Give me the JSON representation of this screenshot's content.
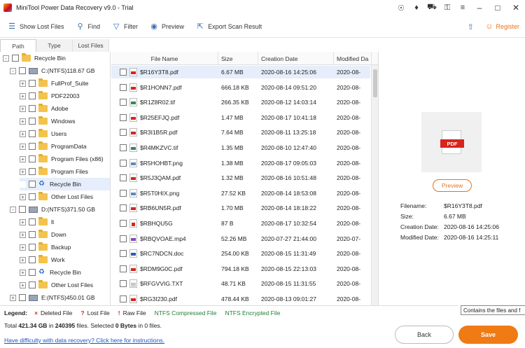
{
  "window": {
    "title": "MiniTool Power Data Recovery v9.0 - Trial",
    "title_icons": [
      "support-icon",
      "tag-icon",
      "cart-icon",
      "key-icon",
      "menu-icon"
    ],
    "controls": [
      "minimize",
      "maximize",
      "close"
    ]
  },
  "toolbar": {
    "show_lost_files": "Show Lost Files",
    "find": "Find",
    "filter": "Filter",
    "preview": "Preview",
    "export_scan_result": "Export Scan Result",
    "register": "Register"
  },
  "tabs": [
    "Path",
    "Type",
    "Lost Files"
  ],
  "tree": [
    {
      "label": "Recycle Bin",
      "icon": "folder",
      "level": 0,
      "expander": "-"
    },
    {
      "label": "C:(NTFS)118.67 GB",
      "icon": "drive",
      "level": 1,
      "expander": "-"
    },
    {
      "label": "FullProf_Suite",
      "icon": "folder",
      "level": 2,
      "expander": "+"
    },
    {
      "label": "PDF22003",
      "icon": "folder",
      "level": 2,
      "expander": "+"
    },
    {
      "label": "Adobe",
      "icon": "folder",
      "level": 2,
      "expander": "+"
    },
    {
      "label": "Windows",
      "icon": "folder",
      "level": 2,
      "expander": "+"
    },
    {
      "label": "Users",
      "icon": "folder",
      "level": 2,
      "expander": "+"
    },
    {
      "label": "ProgramData",
      "icon": "folder",
      "level": 2,
      "expander": "+"
    },
    {
      "label": "Program Files (x86)",
      "icon": "folder",
      "level": 2,
      "expander": "+"
    },
    {
      "label": "Program Files",
      "icon": "folder",
      "level": 2,
      "expander": "+"
    },
    {
      "label": "Recycle Bin",
      "icon": "recycle",
      "level": 2,
      "expander": "",
      "selected": true
    },
    {
      "label": "Other Lost Files",
      "icon": "folder",
      "level": 2,
      "expander": "+"
    },
    {
      "label": "D:(NTFS)371.50 GB",
      "icon": "drive",
      "level": 1,
      "expander": "-"
    },
    {
      "label": "lt",
      "icon": "folder",
      "level": 2,
      "expander": "+"
    },
    {
      "label": "Down",
      "icon": "folder",
      "level": 2,
      "expander": "+"
    },
    {
      "label": "Backup",
      "icon": "folder",
      "level": 2,
      "expander": "+"
    },
    {
      "label": "Work",
      "icon": "folder",
      "level": 2,
      "expander": "+"
    },
    {
      "label": "Recycle Bin",
      "icon": "recycle",
      "level": 2,
      "expander": "+"
    },
    {
      "label": "Other Lost Files",
      "icon": "folder",
      "level": 2,
      "expander": "+"
    },
    {
      "label": "E:(NTFS)450.01 GB",
      "icon": "drive",
      "level": 1,
      "expander": "+"
    }
  ],
  "filelist": {
    "columns": [
      "File Name",
      "Size",
      "Creation Date",
      "Modified Da"
    ],
    "rows": [
      {
        "name": "$R16Y3T8.pdf",
        "size": "6.67 MB",
        "created": "2020-08-16 14:25:06",
        "modified": "2020-08-",
        "type": "pdf",
        "selected": true
      },
      {
        "name": "$R1HONN7.pdf",
        "size": "666.18 KB",
        "created": "2020-08-14 09:51:20",
        "modified": "2020-08-",
        "type": "pdf"
      },
      {
        "name": "$R1Z8R02.tif",
        "size": "266.35 KB",
        "created": "2020-08-12 14:03:14",
        "modified": "2020-08-",
        "type": "tif"
      },
      {
        "name": "$R25EFJQ.pdf",
        "size": "1.47 MB",
        "created": "2020-08-17 10:41:18",
        "modified": "2020-08-",
        "type": "pdf"
      },
      {
        "name": "$R3I1B5R.pdf",
        "size": "7.64 MB",
        "created": "2020-08-11 13:25:18",
        "modified": "2020-08-",
        "type": "pdf"
      },
      {
        "name": "$R4MKZVC.tif",
        "size": "1.35 MB",
        "created": "2020-08-10 12:47:40",
        "modified": "2020-08-",
        "type": "tif"
      },
      {
        "name": "$R5HOHBT.png",
        "size": "1.38 MB",
        "created": "2020-08-17 09:05:03",
        "modified": "2020-08-",
        "type": "png"
      },
      {
        "name": "$R5J3QAM.pdf",
        "size": "1.32 MB",
        "created": "2020-08-16 10:51:48",
        "modified": "2020-08-",
        "type": "pdf"
      },
      {
        "name": "$R5T0HIX.png",
        "size": "27.52 KB",
        "created": "2020-08-14 18:53:08",
        "modified": "2020-08-",
        "type": "png"
      },
      {
        "name": "$RB6UN5R.pdf",
        "size": "1.70 MB",
        "created": "2020-08-14 18:18:22",
        "modified": "2020-08-",
        "type": "pdf"
      },
      {
        "name": "$RBHQU5G",
        "size": "87 B",
        "created": "2020-08-17 10:32:54",
        "modified": "2020-08-",
        "type": "gen"
      },
      {
        "name": "$RBQVOAE.mp4",
        "size": "52.26 MB",
        "created": "2020-07-27 21:44:00",
        "modified": "2020-07-",
        "type": "mp4"
      },
      {
        "name": "$RC7NDCN.doc",
        "size": "254.00 KB",
        "created": "2020-08-15 11:31:49",
        "modified": "2020-08-",
        "type": "doc"
      },
      {
        "name": "$RDM9G0C.pdf",
        "size": "794.18 KB",
        "created": "2020-08-15 22:13:03",
        "modified": "2020-08-",
        "type": "pdf"
      },
      {
        "name": "$RFGVVIG.TXT",
        "size": "48.71 KB",
        "created": "2020-08-15 11:31:55",
        "modified": "2020-08-",
        "type": "txt"
      },
      {
        "name": "$RG3I230.pdf",
        "size": "478.44 KB",
        "created": "2020-08-13 09:01:27",
        "modified": "2020-08-",
        "type": "pdf"
      }
    ]
  },
  "preview_panel": {
    "thumb_label": "PDF",
    "button": "Preview",
    "fields": [
      {
        "key": "Filename:",
        "value": "$R16Y3T8.pdf"
      },
      {
        "key": "Size:",
        "value": "6.67 MB"
      },
      {
        "key": "Creation Date:",
        "value": "2020-08-16 14:25:06"
      },
      {
        "key": "Modified Date:",
        "value": "2020-08-16 14:25:11"
      }
    ]
  },
  "tooltip": "Contains the files and f",
  "legend": {
    "title": "Legend:",
    "items": [
      {
        "mark": "×",
        "label": "Deleted File"
      },
      {
        "mark": "?",
        "label": "Lost File"
      },
      {
        "mark": "!",
        "label": "Raw File"
      },
      {
        "mark": "",
        "label": "NTFS Compressed File"
      },
      {
        "mark": "",
        "label": "NTFS Encrypted File"
      }
    ]
  },
  "status": {
    "total_prefix": "Total ",
    "total_size": "421.34 GB",
    "in": " in ",
    "file_count": "240395",
    "files_selected": " files.  Selected ",
    "selected_size": "0 Bytes",
    "selected_suffix": " in 0 files."
  },
  "help_link": "Have difficulty with data recovery? Click here for instructions.",
  "buttons": {
    "back": "Back",
    "save": "Save"
  },
  "colors": {
    "accent": "#f07a14",
    "selection": "#e5eefa",
    "link": "#1a55c4",
    "ntfs_green": "#1e7e34"
  }
}
